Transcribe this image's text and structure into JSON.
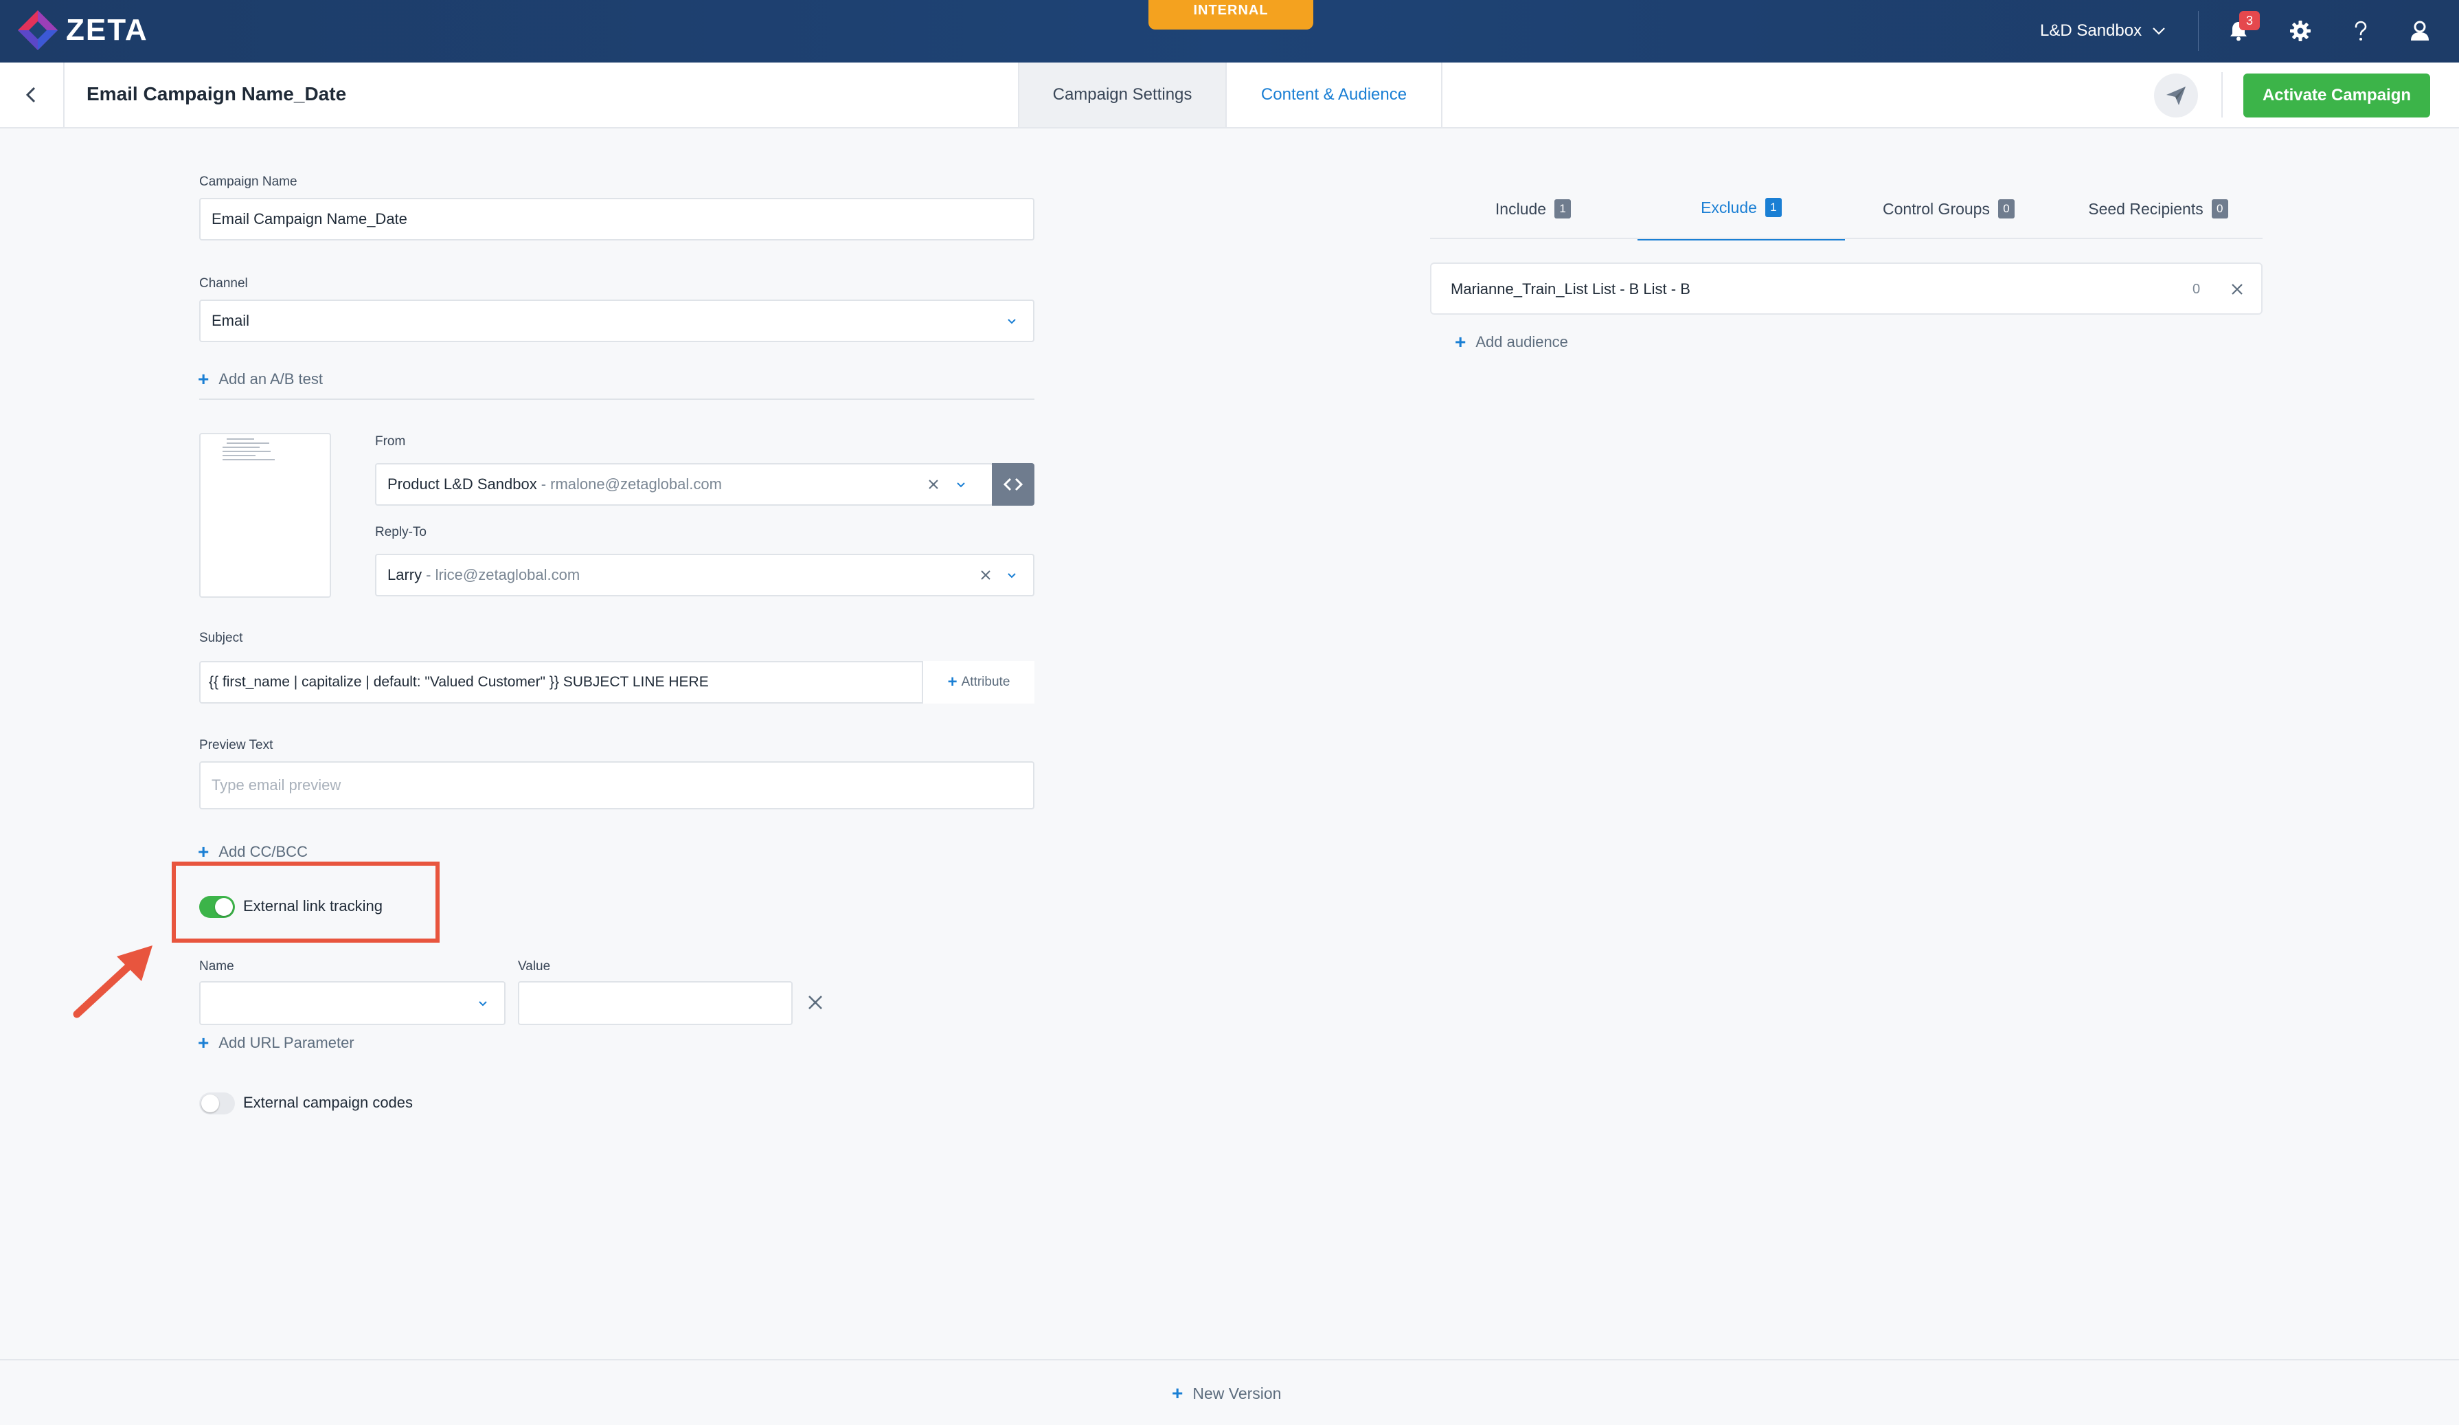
{
  "topnav": {
    "logo_text": "ZETA",
    "environment_badge": "INTERNAL",
    "account_name": "L&D Sandbox",
    "notification_count": "3"
  },
  "header": {
    "page_title": "Email Campaign Name_Date",
    "tabs": [
      {
        "label": "Campaign Settings",
        "active": false
      },
      {
        "label": "Content & Audience",
        "active": true
      }
    ],
    "activate_label": "Activate Campaign"
  },
  "form": {
    "campaign_name": {
      "label": "Campaign Name",
      "value": "Email Campaign Name_Date"
    },
    "channel": {
      "label": "Channel",
      "value": "Email"
    },
    "add_ab_test": "Add an A/B test",
    "from": {
      "label": "From",
      "name": "Product L&D Sandbox",
      "email": "- rmalone@zetaglobal.com"
    },
    "reply_to": {
      "label": "Reply-To",
      "name": "Larry",
      "email": "- lrice@zetaglobal.com"
    },
    "subject": {
      "label": "Subject",
      "value": "{{ first_name | capitalize | default: \"Valued Customer\" }} SUBJECT LINE HERE",
      "attribute_label": "Attribute"
    },
    "preview_text": {
      "label": "Preview Text",
      "placeholder": "Type email preview"
    },
    "add_cc_bcc": "Add CC/BCC",
    "external_link_tracking": {
      "label": "External link tracking",
      "enabled": true
    },
    "url_param": {
      "name_label": "Name",
      "value_label": "Value",
      "name_value": "",
      "value_value": ""
    },
    "add_url_param": "Add URL Parameter",
    "external_campaign_codes": {
      "label": "External campaign codes",
      "enabled": false
    }
  },
  "audience": {
    "tabs": [
      {
        "label": "Include",
        "count": "1",
        "active": false
      },
      {
        "label": "Exclude",
        "count": "1",
        "active": true
      },
      {
        "label": "Control Groups",
        "count": "0",
        "active": false
      },
      {
        "label": "Seed Recipients",
        "count": "0",
        "active": false
      }
    ],
    "rows": [
      {
        "name": "Marianne_Train_List List - B List - B",
        "count": "0"
      }
    ],
    "add_audience": "Add audience"
  },
  "footer": {
    "new_version": "New Version"
  },
  "colors": {
    "accent": "#1a7fd4",
    "success": "#3cb449",
    "nav": "#1e4375",
    "badge": "#f4a21f",
    "highlight": "#e8553e"
  }
}
